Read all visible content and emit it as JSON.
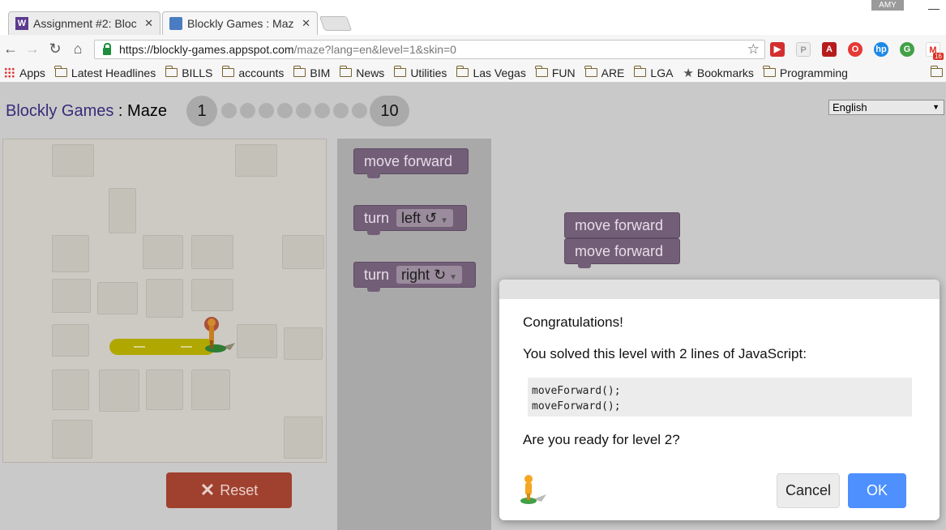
{
  "browser": {
    "tabs": [
      {
        "title": "Assignment #2: Bloc",
        "icon": "w-logo-icon"
      },
      {
        "title": "Blockly Games : Maz",
        "icon": "puzzle-icon"
      }
    ],
    "profile_label": "AMY",
    "url_host": "https://blockly-games.appspot.com",
    "url_rest": "/maze?lang=en&level=1&skin=0",
    "extension_badge": "16",
    "bookmarks": [
      "Apps",
      "Latest Headlines",
      "BILLS",
      "accounts",
      "BIM",
      "News",
      "Utilities",
      "Las Vegas",
      "FUN",
      "ARE",
      "LGA",
      "Bookmarks",
      "Programming"
    ]
  },
  "page": {
    "brand": "Blockly Games",
    "separator": " : ",
    "game": "Maze",
    "level_first": "1",
    "level_last": "10",
    "language": "English",
    "reset_label": "Reset"
  },
  "toolbox": {
    "move_forward": "move forward",
    "turn": "turn",
    "left": "left ↺",
    "right": "right ↻"
  },
  "workspace": {
    "blocks": [
      "move forward",
      "move forward"
    ]
  },
  "dialog": {
    "title": "Congratulations!",
    "message": "You solved this level with 2 lines of JavaScript:",
    "code": [
      "moveForward();",
      "moveForward();"
    ],
    "question": "Are you ready for level 2?",
    "cancel_label": "Cancel",
    "ok_label": "OK"
  },
  "colors": {
    "block": "#735e78",
    "ok_button": "#4d90fe",
    "reset_button": "#a0402e",
    "path": "#b0a800"
  }
}
